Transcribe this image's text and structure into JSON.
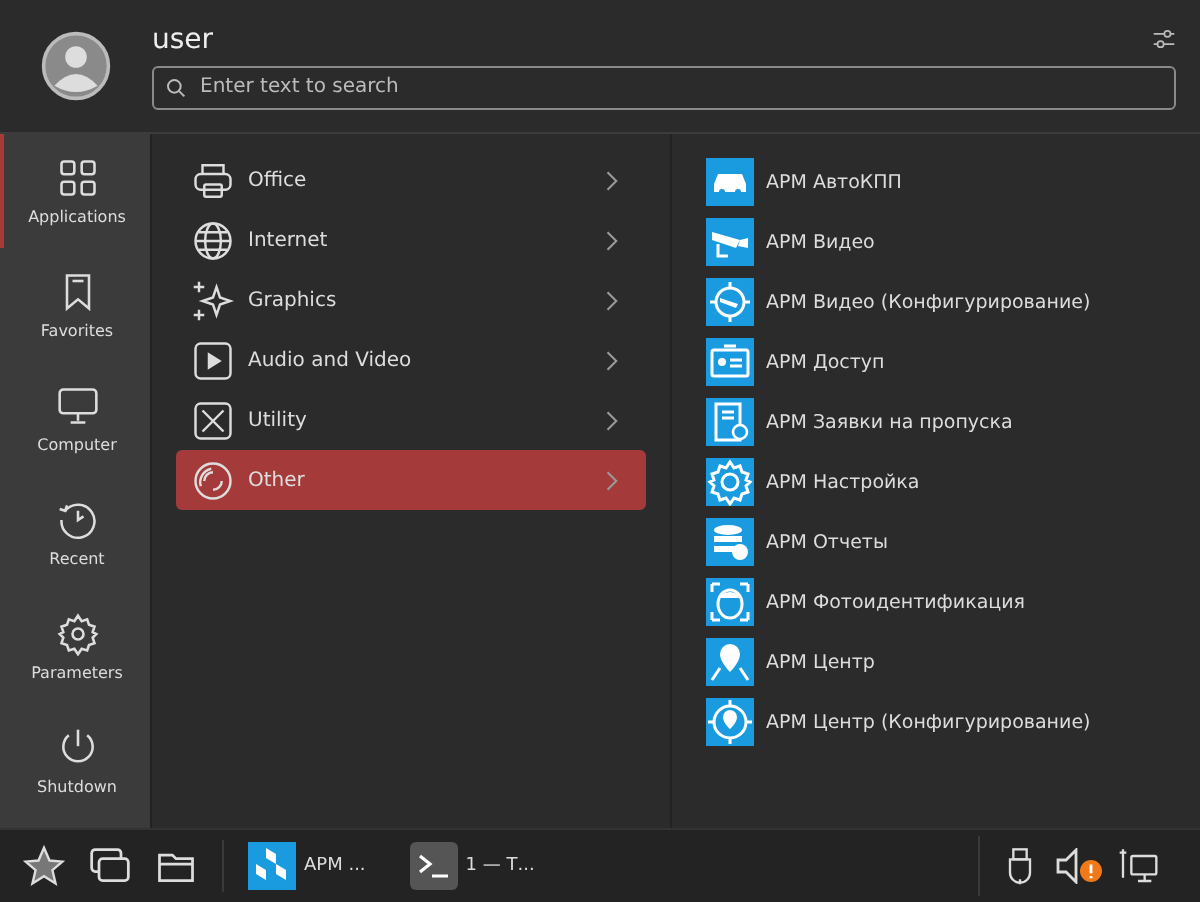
{
  "user": {
    "name": "user"
  },
  "search": {
    "placeholder": "Enter text to search"
  },
  "sidebar": {
    "items": [
      {
        "label": "Applications",
        "selected": true
      },
      {
        "label": "Favorites",
        "selected": false
      },
      {
        "label": "Computer",
        "selected": false
      },
      {
        "label": "Recent",
        "selected": false
      },
      {
        "label": "Parameters",
        "selected": false
      },
      {
        "label": "Shutdown",
        "selected": false
      }
    ]
  },
  "categories": [
    {
      "label": "Office",
      "selected": false
    },
    {
      "label": "Internet",
      "selected": false
    },
    {
      "label": "Graphics",
      "selected": false
    },
    {
      "label": "Audio and Video",
      "selected": false
    },
    {
      "label": "Utility",
      "selected": false
    },
    {
      "label": "Other",
      "selected": true
    }
  ],
  "apps": [
    {
      "label": "АРМ АвтоКПП"
    },
    {
      "label": "АРМ Видео"
    },
    {
      "label": "АРМ Видео (Конфигурирование)"
    },
    {
      "label": "АРМ Доступ"
    },
    {
      "label": "АРМ Заявки на пропуска"
    },
    {
      "label": "АРМ Настройка"
    },
    {
      "label": "АРМ Отчеты"
    },
    {
      "label": "АРМ Фотоидентификация"
    },
    {
      "label": "АРМ Центр"
    },
    {
      "label": "АРМ Центр (Конфигурирование)"
    }
  ],
  "taskbar": {
    "tasks": [
      {
        "label": "АРМ ...",
        "kind": "app"
      },
      {
        "label": "1 — Т...",
        "kind": "terminal"
      }
    ],
    "tray": {
      "volume_alert": true
    }
  }
}
